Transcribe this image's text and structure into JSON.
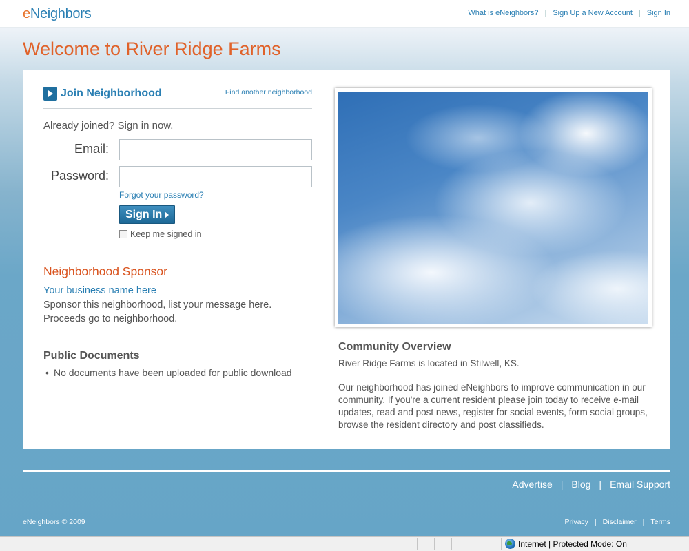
{
  "header": {
    "logo_e": "e",
    "logo_rest": "Neighbors",
    "links": [
      "What is eNeighbors?",
      "Sign Up a New Account",
      "Sign In"
    ]
  },
  "page_title": "Welcome to River Ridge Farms",
  "join": {
    "label": "Join Neighborhood",
    "find_link": "Find another neighborhood"
  },
  "login": {
    "intro": "Already joined? Sign in now.",
    "email_label": "Email:",
    "email_value": "",
    "password_label": "Password:",
    "password_value": "",
    "forgot_link": "Forgot your password?",
    "signin_button": "Sign In",
    "keep_signed_in": "Keep me signed in",
    "keep_checked": false
  },
  "sponsor": {
    "heading": "Neighborhood Sponsor",
    "link": "Your business name here",
    "text": "Sponsor this neighborhood, list your message here. Proceeds go to neighborhood."
  },
  "documents": {
    "heading": "Public Documents",
    "bullet": "•",
    "items": [
      "No documents have been uploaded for public download"
    ]
  },
  "overview": {
    "heading": "Community Overview",
    "location": "River Ridge Farms is located in Stilwell, KS.",
    "description": "Our neighborhood has joined eNeighbors to improve communication in our community. If you're a current resident please join today to receive e-mail updates, read and post news, register for social events, form social groups, browse the resident directory and post classifieds."
  },
  "footer": {
    "links": [
      "Advertise",
      "Blog",
      "Email Support"
    ],
    "copyright": "eNeighbors © 2009",
    "legal_links": [
      "Privacy",
      "Disclaimer",
      "Terms"
    ],
    "separator": "|"
  },
  "status_bar": {
    "zone_text": "Internet | Protected Mode: On"
  },
  "colors": {
    "accent_blue": "#2a7fb3",
    "accent_orange": "#e0622a",
    "background_blue": "#66a5c7"
  }
}
